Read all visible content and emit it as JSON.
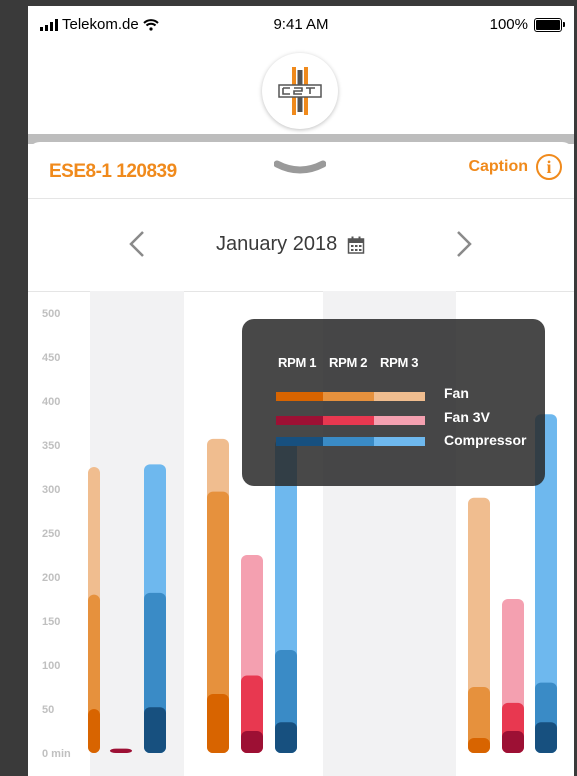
{
  "status_bar": {
    "carrier": "Telekom.de",
    "time": "9:41 AM",
    "battery": "100%"
  },
  "header": {
    "device_id": "ESE8-1 120839",
    "caption_label": "Caption",
    "info_icon": "i"
  },
  "month_nav": {
    "label": "January 2018"
  },
  "colors": {
    "orange": [
      "#d86400",
      "#e6913d",
      "#f0bd8f"
    ],
    "red": [
      "#9d1034",
      "#e83850",
      "#f4a0b0"
    ],
    "blue": [
      "#17507f",
      "#3a8bc6",
      "#6eb8ee"
    ]
  },
  "legend": {
    "headers": [
      "RPM 1",
      "RPM 2",
      "RPM 3"
    ],
    "series": [
      "Fan",
      "Fan 3V",
      "Compressor"
    ]
  },
  "chart_data": {
    "type": "bar",
    "y_tick_labels": [
      "0 min",
      "50",
      "100",
      "150",
      "200",
      "250",
      "300",
      "350",
      "400",
      "450",
      "500"
    ],
    "ylim": [
      0,
      500
    ],
    "y_ticks": [
      0,
      50,
      100,
      150,
      200,
      250,
      300,
      350,
      400,
      450,
      500
    ],
    "groups": [
      {
        "name": "Fan",
        "levels": [
          50,
          180,
          325
        ]
      },
      {
        "name": "Fan 3V",
        "levels": [
          5
        ]
      },
      {
        "name": "Compressor",
        "levels": [
          52,
          182,
          328
        ]
      },
      {
        "name": "Fan",
        "levels": [
          67,
          297,
          357
        ]
      },
      {
        "name": "Fan 3V",
        "levels": [
          25,
          88,
          225
        ]
      },
      {
        "name": "Compressor",
        "levels": [
          35,
          117,
          357
        ]
      },
      {
        "name": "Fan",
        "levels": [
          17,
          75,
          290
        ]
      },
      {
        "name": "Fan 3V",
        "levels": [
          25,
          57,
          175
        ]
      },
      {
        "name": "Compressor",
        "levels": [
          35,
          80,
          385
        ]
      }
    ]
  }
}
